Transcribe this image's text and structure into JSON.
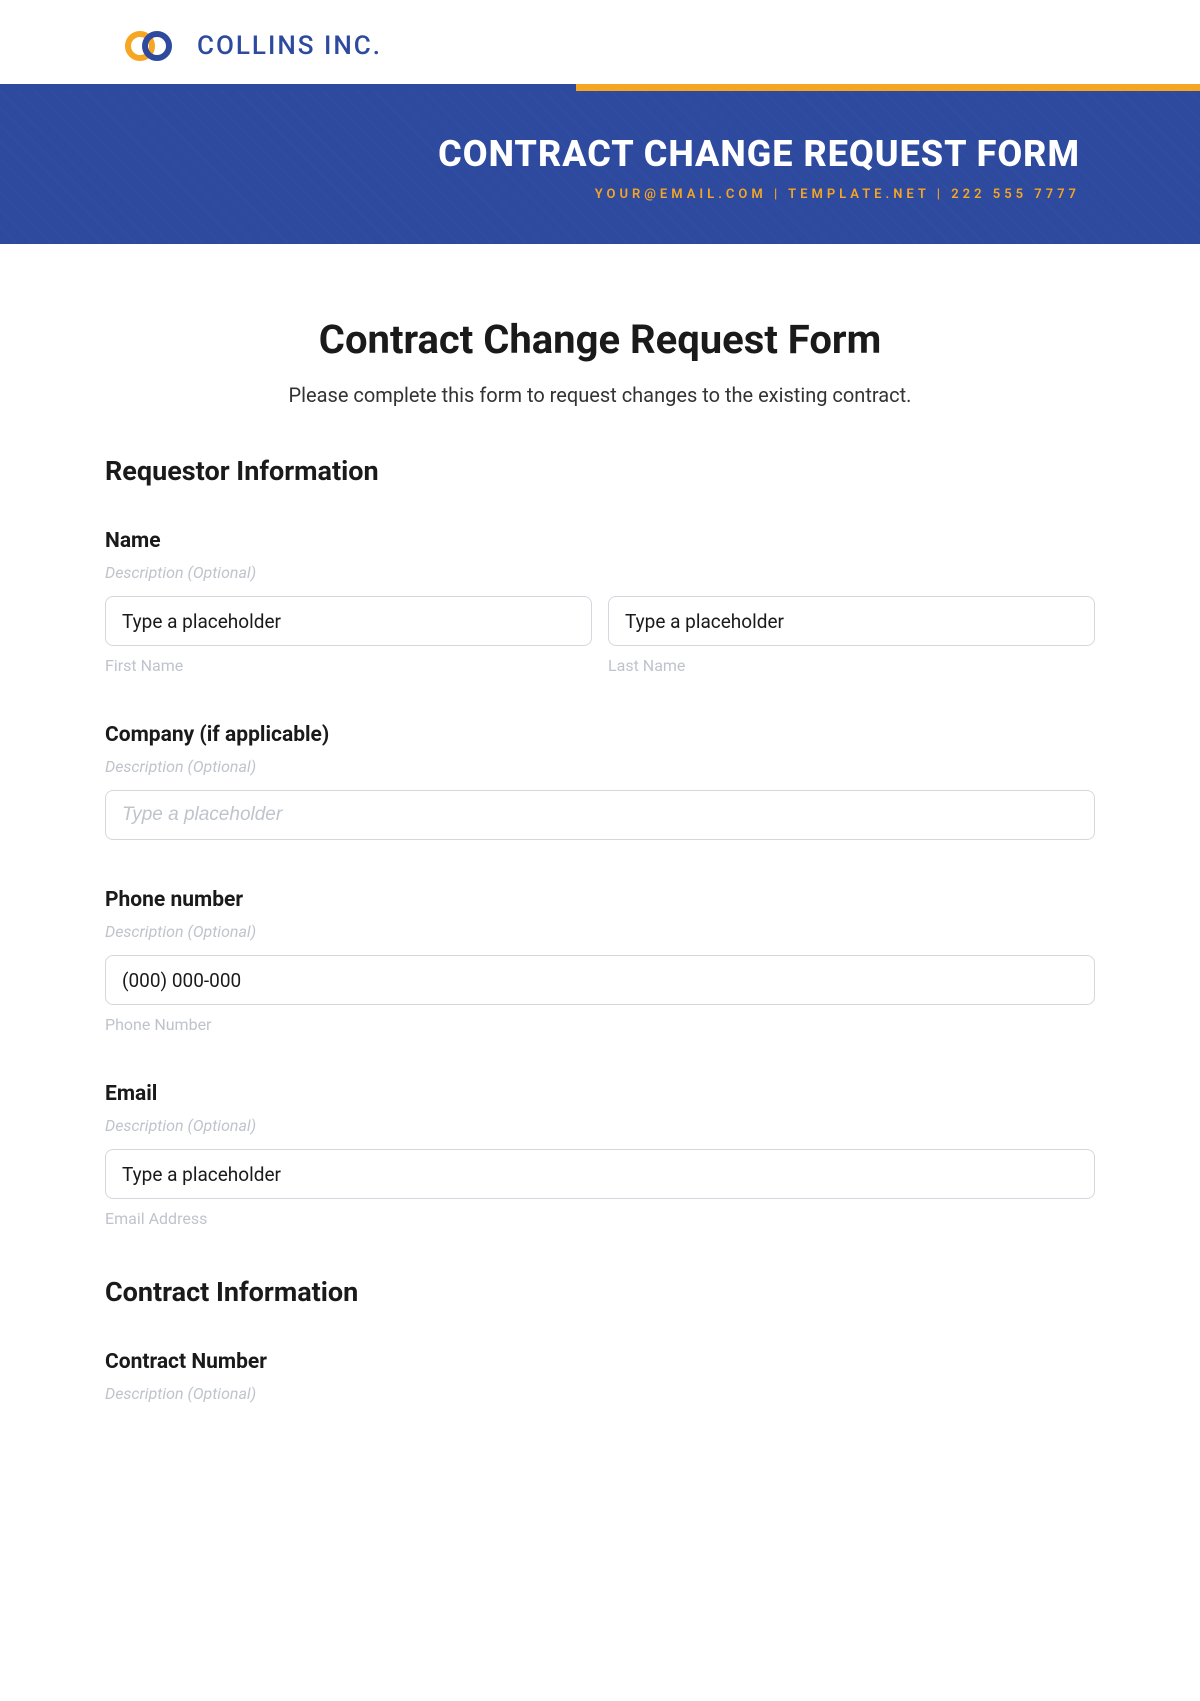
{
  "header": {
    "company_name": "COLLINS INC."
  },
  "hero": {
    "title": "CONTRACT CHANGE REQUEST FORM",
    "contact": "YOUR@EMAIL.COM | TEMPLATE.NET | 222 555 7777"
  },
  "form": {
    "title": "Contract Change Request Form",
    "subtitle": "Please complete this form to request changes to the existing contract."
  },
  "sections": {
    "requestor": {
      "heading": "Requestor Information",
      "name": {
        "label": "Name",
        "description": "Description (Optional)",
        "first_placeholder": "Type a placeholder",
        "first_sublabel": "First Name",
        "last_placeholder": "Type a placeholder",
        "last_sublabel": "Last Name"
      },
      "company": {
        "label": "Company (if applicable)",
        "description": "Description (Optional)",
        "placeholder": "Type a placeholder"
      },
      "phone": {
        "label": "Phone number",
        "description": "Description (Optional)",
        "placeholder": "(000) 000-000",
        "sublabel": "Phone Number"
      },
      "email": {
        "label": "Email",
        "description": "Description (Optional)",
        "placeholder": "Type a placeholder",
        "sublabel": "Email Address"
      }
    },
    "contract": {
      "heading": "Contract Information",
      "number": {
        "label": "Contract Number",
        "description": "Description (Optional)"
      }
    }
  }
}
